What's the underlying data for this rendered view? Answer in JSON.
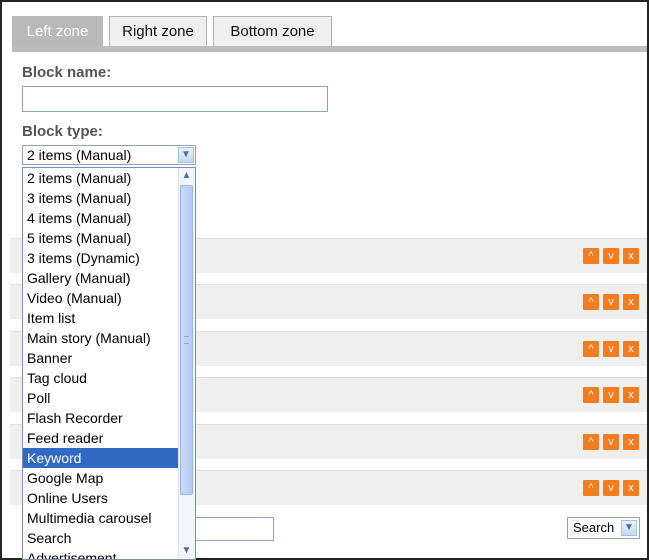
{
  "tabs": [
    {
      "label": "Left zone"
    },
    {
      "label": "Right zone"
    },
    {
      "label": "Bottom zone"
    }
  ],
  "form": {
    "block_name_label": "Block name:",
    "block_name_value": "",
    "block_type_label": "Block type:",
    "block_type_value": "2 items (Manual)"
  },
  "dropdown": {
    "options": [
      "2 items (Manual)",
      "3 items (Manual)",
      "4 items (Manual)",
      "5 items (Manual)",
      "3 items (Dynamic)",
      "Gallery (Manual)",
      "Video (Manual)",
      "Item list",
      "Main story (Manual)",
      "Banner",
      "Tag cloud",
      "Poll",
      "Flash Recorder",
      "Feed reader",
      "Keyword",
      "Google Map",
      "Online Users",
      "Multimedia carousel",
      "Search",
      "Advertisement"
    ],
    "highlighted": "Keyword"
  },
  "row_actions": {
    "up_icon": "^",
    "down_icon": "v",
    "delete_icon": "x"
  },
  "bottom": {
    "select_value": "Search"
  },
  "colors": {
    "accent_orange": "#f47c1f",
    "selection_blue": "#316ac5",
    "tab_active": "#b9b9b9"
  }
}
